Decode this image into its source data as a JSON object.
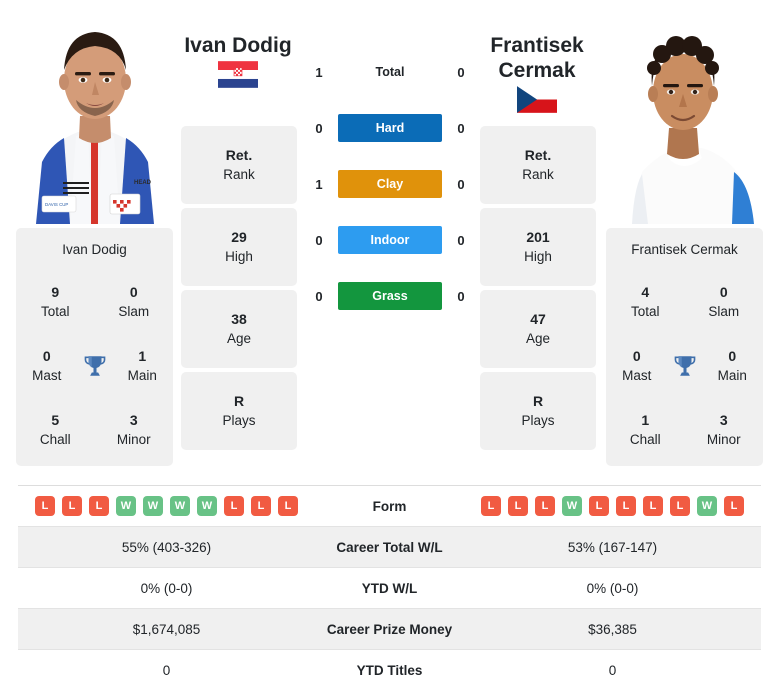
{
  "players": {
    "left": {
      "name": "Ivan Dodig",
      "flag": "croatia-flag",
      "card_name": "Ivan Dodig",
      "rank_value": "Ret.",
      "rank_label": "Rank",
      "high_value": "29",
      "high_label": "High",
      "age_value": "38",
      "age_label": "Age",
      "plays_value": "R",
      "plays_label": "Plays",
      "titles": {
        "total_value": "9",
        "total_label": "Total",
        "slam_value": "0",
        "slam_label": "Slam",
        "mast_value": "0",
        "mast_label": "Mast",
        "main_value": "1",
        "main_label": "Main",
        "chall_value": "5",
        "chall_label": "Chall",
        "minor_value": "3",
        "minor_label": "Minor"
      },
      "form": [
        "L",
        "L",
        "L",
        "W",
        "W",
        "W",
        "W",
        "L",
        "L",
        "L"
      ],
      "career_total_wl": "55% (403-326)",
      "ytd_wl": "0% (0-0)",
      "career_prize_money": "$1,674,085",
      "ytd_titles": "0"
    },
    "right": {
      "name": "Frantisek Cermak",
      "name_line1": "Frantisek",
      "name_line2": "Cermak",
      "flag": "czech-republic-flag",
      "card_name": "Frantisek Cermak",
      "rank_value": "Ret.",
      "rank_label": "Rank",
      "high_value": "201",
      "high_label": "High",
      "age_value": "47",
      "age_label": "Age",
      "plays_value": "R",
      "plays_label": "Plays",
      "titles": {
        "total_value": "4",
        "total_label": "Total",
        "slam_value": "0",
        "slam_label": "Slam",
        "mast_value": "0",
        "mast_label": "Mast",
        "main_value": "0",
        "main_label": "Main",
        "chall_value": "1",
        "chall_label": "Chall",
        "minor_value": "3",
        "minor_label": "Minor"
      },
      "form": [
        "L",
        "L",
        "L",
        "W",
        "L",
        "L",
        "L",
        "L",
        "W",
        "L"
      ],
      "career_total_wl": "53% (167-147)",
      "ytd_wl": "0% (0-0)",
      "career_prize_money": "$36,385",
      "ytd_titles": "0"
    }
  },
  "head_to_head": [
    {
      "label": "Total",
      "left": "1",
      "right": "0",
      "style": "plain",
      "color": ""
    },
    {
      "label": "Hard",
      "left": "0",
      "right": "0",
      "style": "chip",
      "color": "#0b6cb7"
    },
    {
      "label": "Clay",
      "left": "1",
      "right": "0",
      "style": "chip",
      "color": "#e0920b"
    },
    {
      "label": "Indoor",
      "left": "0",
      "right": "0",
      "style": "chip",
      "color": "#2d9cf0"
    },
    {
      "label": "Grass",
      "left": "0",
      "right": "0",
      "style": "chip",
      "color": "#13963e"
    }
  ],
  "stats_table": [
    {
      "label": "Form",
      "key": "form",
      "type": "form"
    },
    {
      "label": "Career Total W/L",
      "key": "career_total_wl",
      "type": "text"
    },
    {
      "label": "YTD W/L",
      "key": "ytd_wl",
      "type": "text"
    },
    {
      "label": "Career Prize Money",
      "key": "career_prize_money",
      "type": "text"
    },
    {
      "label": "YTD Titles",
      "key": "ytd_titles",
      "type": "text"
    }
  ],
  "colors": {
    "card_bg": "#f0f0f0",
    "win_badge": "#68c286",
    "loss_badge": "#f15b42",
    "trophy": "#3f6fab"
  }
}
